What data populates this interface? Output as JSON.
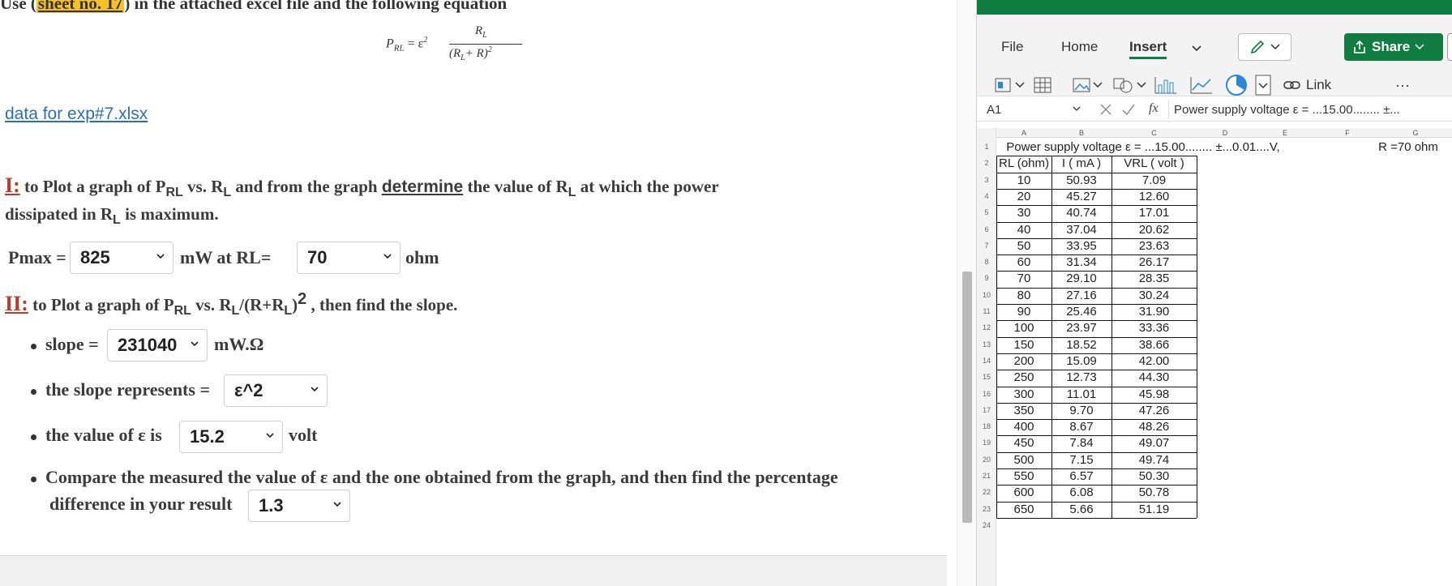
{
  "doc": {
    "line1": {
      "prefix": "Use (",
      "highlight": "sheet no. 17",
      "suffix": ") in the attached excel file and the following equation"
    },
    "equation": {
      "lhs": "P",
      "lhs_sub": "RL",
      "eq": "= ε",
      "eq_sup": "2",
      "num": "R",
      "num_sub": "L",
      "den": "(R",
      "den_sub": "L",
      "den_tail": "+ R)",
      "den_sup": "2"
    },
    "file_link": "data for exp#7.xlsx",
    "q1": {
      "label": "I:",
      "text_a": " to Plot a graph of P",
      "sub_a": "RL",
      "text_b": " vs. R",
      "sub_b": "L",
      "text_c": " and from the graph ",
      "keyword": "determine",
      "text_d": " the value of R",
      "sub_d": "L",
      "text_e": " at which the power",
      "line2_a": "dissipated in R",
      "line2_sub": "L",
      "line2_b": " is maximum."
    },
    "pmax": {
      "label": "Pmax =",
      "value": "825",
      "unit_a": "mW  at  RL=",
      "rl_value": "70",
      "unit_b": "ohm"
    },
    "q2": {
      "label": "II:",
      "text_a": " to Plot a graph of P",
      "sub_a": "RL",
      "text_b": " vs. R",
      "sub_b": "L",
      "text_c": "/(R+R",
      "sub_c": "L",
      "text_d": ")",
      "sup": "2",
      "text_e": " , then find the slope."
    },
    "slope": {
      "label": "slope =",
      "value": "231040",
      "unit": "mW.Ω"
    },
    "represents": {
      "label": "the slope represents =",
      "value": "ε^2"
    },
    "eps": {
      "label": "the value of  ε is",
      "value": "15.2",
      "unit": "volt"
    },
    "compare": {
      "line1": "Compare the measured the value of  ε and the one obtained from the graph, and then find the percentage",
      "line2": "difference in your result",
      "value": "1.3"
    }
  },
  "excel": {
    "tabs": [
      "File",
      "Home",
      "Insert"
    ],
    "share_label": "Share",
    "link_label": "Link",
    "more_label": "···",
    "namebox": "A1",
    "fx_label": "fx",
    "formula_text": "Power supply voltage  ε = ...15.00........ ±...",
    "columns": [
      "A",
      "B",
      "C",
      "D",
      "E",
      "F",
      "G"
    ],
    "row1_text": "Power supply voltage  ε = ...15.00........ ±...0.01....V,",
    "row1_r": "R =70 ohm",
    "headers": [
      "RL (ohm)",
      "I ( mA  )",
      "VRL ( volt  )"
    ],
    "rows": [
      [
        "10",
        "50.93",
        "7.09"
      ],
      [
        "20",
        "45.27",
        "12.60"
      ],
      [
        "30",
        "40.74",
        "17.01"
      ],
      [
        "40",
        "37.04",
        "20.62"
      ],
      [
        "50",
        "33.95",
        "23.63"
      ],
      [
        "60",
        "31.34",
        "26.17"
      ],
      [
        "70",
        "29.10",
        "28.35"
      ],
      [
        "80",
        "27.16",
        "30.24"
      ],
      [
        "90",
        "25.46",
        "31.90"
      ],
      [
        "100",
        "23.97",
        "33.36"
      ],
      [
        "150",
        "18.52",
        "38.66"
      ],
      [
        "200",
        "15.09",
        "42.00"
      ],
      [
        "250",
        "12.73",
        "44.30"
      ],
      [
        "300",
        "11.01",
        "45.98"
      ],
      [
        "350",
        "9.70",
        "47.26"
      ],
      [
        "400",
        "8.67",
        "48.26"
      ],
      [
        "450",
        "7.84",
        "49.07"
      ],
      [
        "500",
        "7.15",
        "49.74"
      ],
      [
        "550",
        "6.57",
        "50.30"
      ],
      [
        "600",
        "6.08",
        "50.78"
      ],
      [
        "650",
        "5.66",
        "51.19"
      ]
    ],
    "row_numbers": [
      "1",
      "2",
      "3",
      "4",
      "5",
      "6",
      "7",
      "8",
      "9",
      "10",
      "11",
      "12",
      "13",
      "14",
      "15",
      "16",
      "17",
      "18",
      "19",
      "20",
      "21",
      "22",
      "23",
      "24"
    ]
  }
}
